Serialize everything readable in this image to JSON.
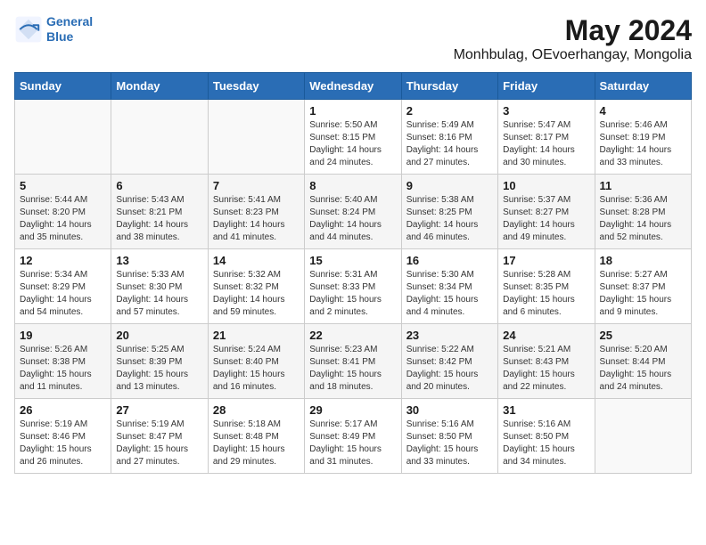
{
  "header": {
    "logo_line1": "General",
    "logo_line2": "Blue",
    "title": "May 2024",
    "subtitle": "Monhbulag, OEvoerhangay, Mongolia"
  },
  "weekdays": [
    "Sunday",
    "Monday",
    "Tuesday",
    "Wednesday",
    "Thursday",
    "Friday",
    "Saturday"
  ],
  "weeks": [
    [
      {
        "day": "",
        "info": ""
      },
      {
        "day": "",
        "info": ""
      },
      {
        "day": "",
        "info": ""
      },
      {
        "day": "1",
        "info": "Sunrise: 5:50 AM\nSunset: 8:15 PM\nDaylight: 14 hours and 24 minutes."
      },
      {
        "day": "2",
        "info": "Sunrise: 5:49 AM\nSunset: 8:16 PM\nDaylight: 14 hours and 27 minutes."
      },
      {
        "day": "3",
        "info": "Sunrise: 5:47 AM\nSunset: 8:17 PM\nDaylight: 14 hours and 30 minutes."
      },
      {
        "day": "4",
        "info": "Sunrise: 5:46 AM\nSunset: 8:19 PM\nDaylight: 14 hours and 33 minutes."
      }
    ],
    [
      {
        "day": "5",
        "info": "Sunrise: 5:44 AM\nSunset: 8:20 PM\nDaylight: 14 hours and 35 minutes."
      },
      {
        "day": "6",
        "info": "Sunrise: 5:43 AM\nSunset: 8:21 PM\nDaylight: 14 hours and 38 minutes."
      },
      {
        "day": "7",
        "info": "Sunrise: 5:41 AM\nSunset: 8:23 PM\nDaylight: 14 hours and 41 minutes."
      },
      {
        "day": "8",
        "info": "Sunrise: 5:40 AM\nSunset: 8:24 PM\nDaylight: 14 hours and 44 minutes."
      },
      {
        "day": "9",
        "info": "Sunrise: 5:38 AM\nSunset: 8:25 PM\nDaylight: 14 hours and 46 minutes."
      },
      {
        "day": "10",
        "info": "Sunrise: 5:37 AM\nSunset: 8:27 PM\nDaylight: 14 hours and 49 minutes."
      },
      {
        "day": "11",
        "info": "Sunrise: 5:36 AM\nSunset: 8:28 PM\nDaylight: 14 hours and 52 minutes."
      }
    ],
    [
      {
        "day": "12",
        "info": "Sunrise: 5:34 AM\nSunset: 8:29 PM\nDaylight: 14 hours and 54 minutes."
      },
      {
        "day": "13",
        "info": "Sunrise: 5:33 AM\nSunset: 8:30 PM\nDaylight: 14 hours and 57 minutes."
      },
      {
        "day": "14",
        "info": "Sunrise: 5:32 AM\nSunset: 8:32 PM\nDaylight: 14 hours and 59 minutes."
      },
      {
        "day": "15",
        "info": "Sunrise: 5:31 AM\nSunset: 8:33 PM\nDaylight: 15 hours and 2 minutes."
      },
      {
        "day": "16",
        "info": "Sunrise: 5:30 AM\nSunset: 8:34 PM\nDaylight: 15 hours and 4 minutes."
      },
      {
        "day": "17",
        "info": "Sunrise: 5:28 AM\nSunset: 8:35 PM\nDaylight: 15 hours and 6 minutes."
      },
      {
        "day": "18",
        "info": "Sunrise: 5:27 AM\nSunset: 8:37 PM\nDaylight: 15 hours and 9 minutes."
      }
    ],
    [
      {
        "day": "19",
        "info": "Sunrise: 5:26 AM\nSunset: 8:38 PM\nDaylight: 15 hours and 11 minutes."
      },
      {
        "day": "20",
        "info": "Sunrise: 5:25 AM\nSunset: 8:39 PM\nDaylight: 15 hours and 13 minutes."
      },
      {
        "day": "21",
        "info": "Sunrise: 5:24 AM\nSunset: 8:40 PM\nDaylight: 15 hours and 16 minutes."
      },
      {
        "day": "22",
        "info": "Sunrise: 5:23 AM\nSunset: 8:41 PM\nDaylight: 15 hours and 18 minutes."
      },
      {
        "day": "23",
        "info": "Sunrise: 5:22 AM\nSunset: 8:42 PM\nDaylight: 15 hours and 20 minutes."
      },
      {
        "day": "24",
        "info": "Sunrise: 5:21 AM\nSunset: 8:43 PM\nDaylight: 15 hours and 22 minutes."
      },
      {
        "day": "25",
        "info": "Sunrise: 5:20 AM\nSunset: 8:44 PM\nDaylight: 15 hours and 24 minutes."
      }
    ],
    [
      {
        "day": "26",
        "info": "Sunrise: 5:19 AM\nSunset: 8:46 PM\nDaylight: 15 hours and 26 minutes."
      },
      {
        "day": "27",
        "info": "Sunrise: 5:19 AM\nSunset: 8:47 PM\nDaylight: 15 hours and 27 minutes."
      },
      {
        "day": "28",
        "info": "Sunrise: 5:18 AM\nSunset: 8:48 PM\nDaylight: 15 hours and 29 minutes."
      },
      {
        "day": "29",
        "info": "Sunrise: 5:17 AM\nSunset: 8:49 PM\nDaylight: 15 hours and 31 minutes."
      },
      {
        "day": "30",
        "info": "Sunrise: 5:16 AM\nSunset: 8:50 PM\nDaylight: 15 hours and 33 minutes."
      },
      {
        "day": "31",
        "info": "Sunrise: 5:16 AM\nSunset: 8:50 PM\nDaylight: 15 hours and 34 minutes."
      },
      {
        "day": "",
        "info": ""
      }
    ]
  ]
}
